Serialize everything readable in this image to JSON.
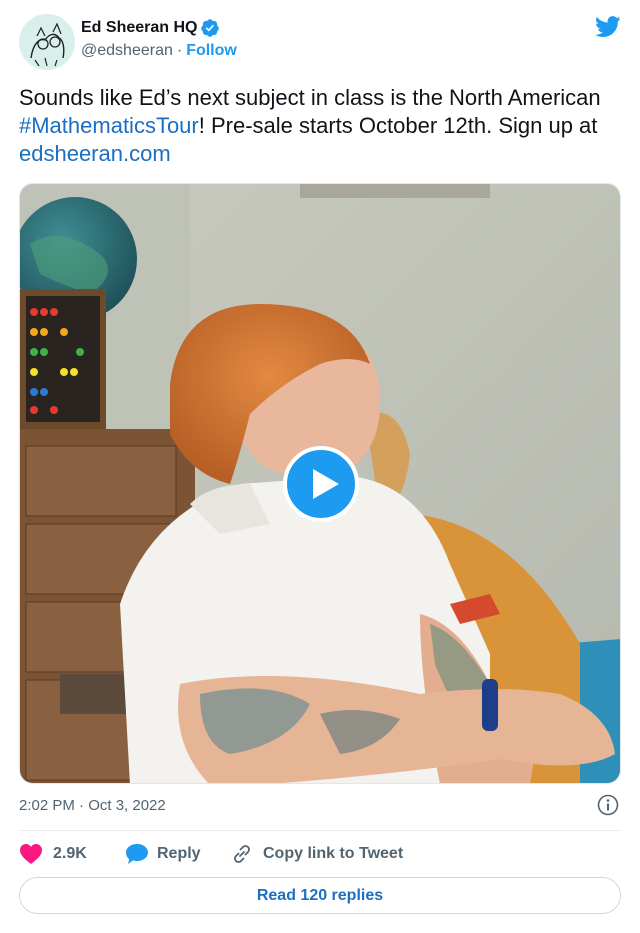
{
  "author": {
    "display_name": "Ed Sheeran HQ",
    "handle": "@edsheeran",
    "separator": "·",
    "follow_label": "Follow",
    "verified": true
  },
  "tweet": {
    "text_part1": "Sounds like Ed’s next subject in class is the North American ",
    "hashtag": "#MathematicsTour",
    "text_part2": "! Pre-sale starts October 12th. Sign up at ",
    "link": "edsheeran.com"
  },
  "media": {
    "type": "video",
    "play_icon": "play-icon"
  },
  "meta": {
    "timestamp": "2:02 PM · Oct 3, 2022",
    "info_icon": "info-icon"
  },
  "actions": {
    "like_count": "2.9K",
    "reply_label": "Reply",
    "copy_label": "Copy link to Tweet"
  },
  "footer": {
    "read_replies": "Read 120 replies"
  },
  "colors": {
    "accent": "#1d9bf0",
    "like": "#f91880",
    "text": "#0f1419",
    "secondary": "#536471"
  }
}
